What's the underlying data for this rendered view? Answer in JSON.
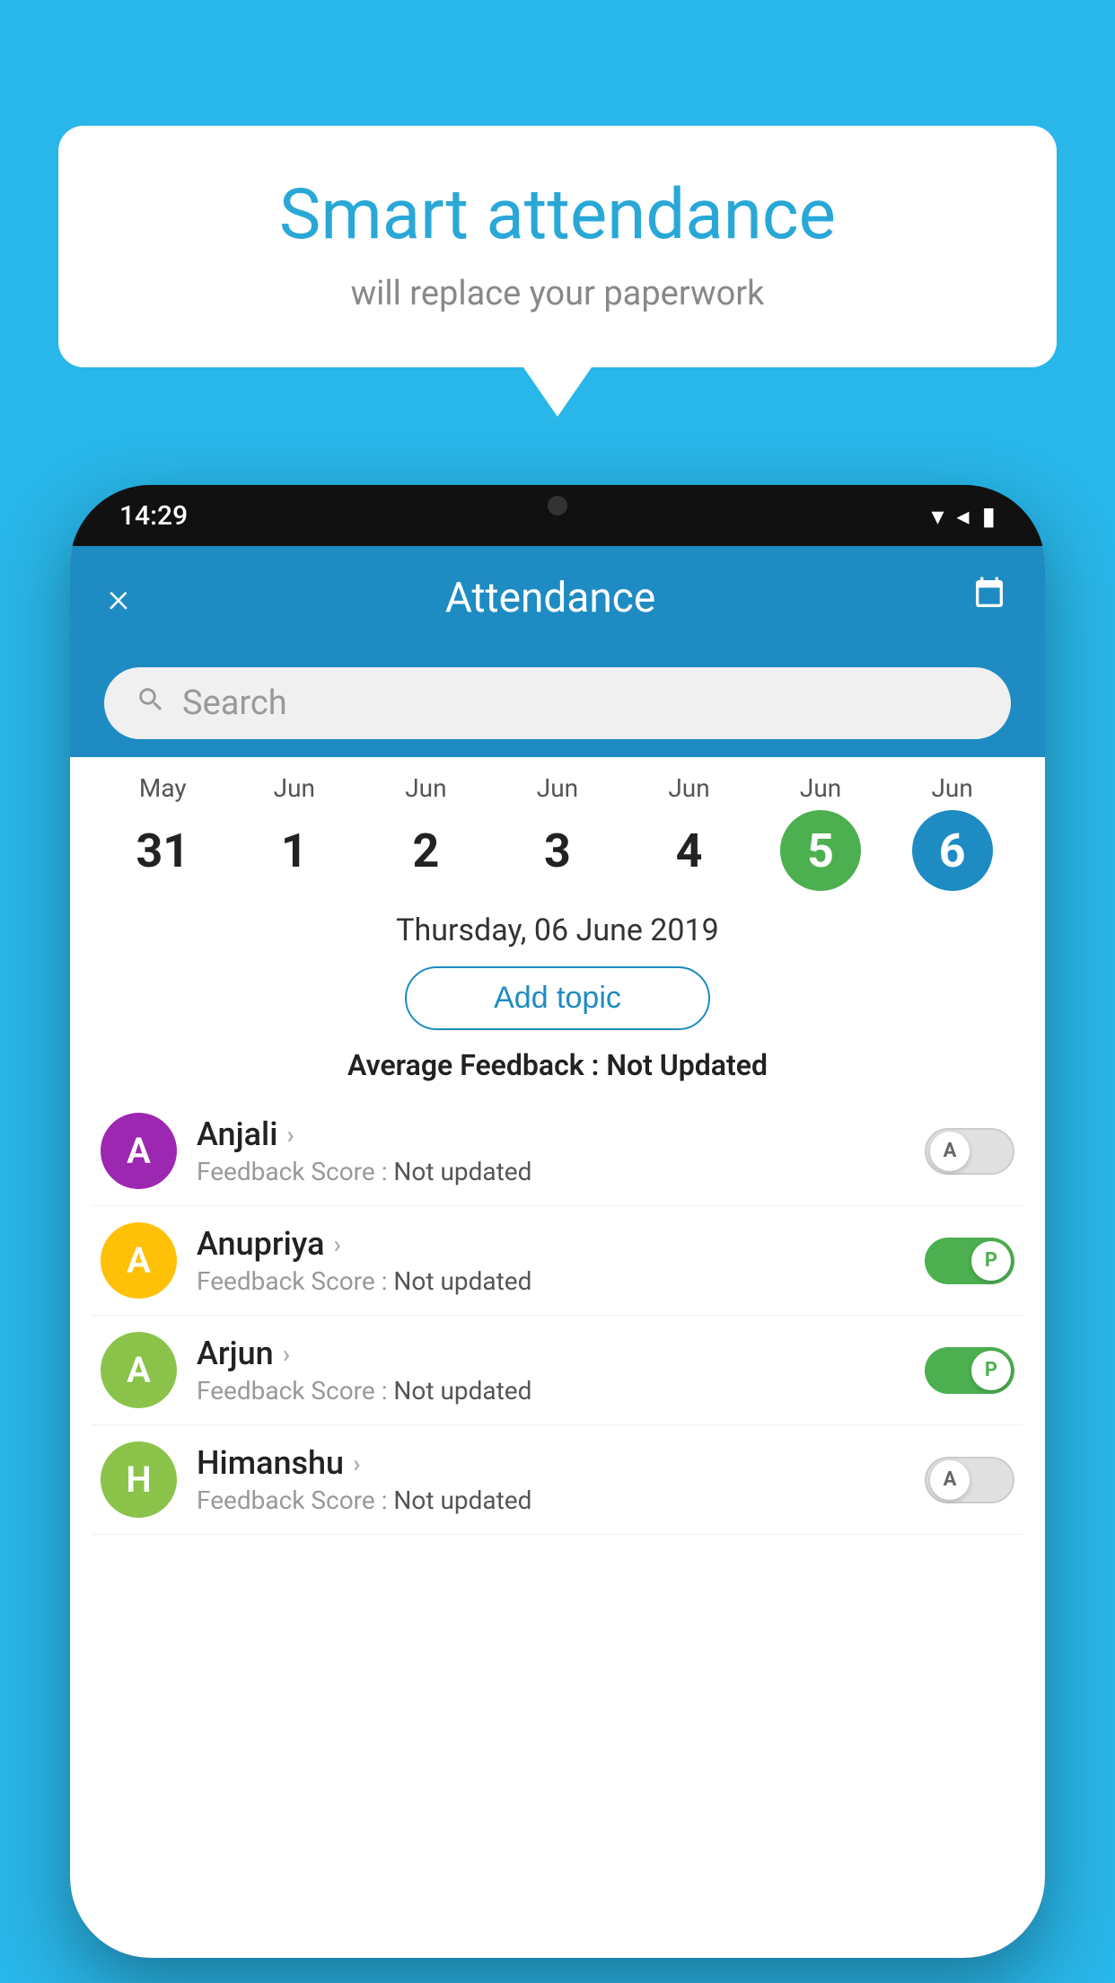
{
  "background": {
    "color": "#29B6E8"
  },
  "speech_bubble": {
    "title": "Smart attendance",
    "subtitle": "will replace your paperwork"
  },
  "phone": {
    "status_bar": {
      "time": "14:29"
    },
    "app_bar": {
      "title": "Attendance",
      "close_label": "×"
    },
    "search": {
      "placeholder": "Search"
    },
    "calendar": {
      "days": [
        {
          "month": "May",
          "date": "31",
          "style": "normal"
        },
        {
          "month": "Jun",
          "date": "1",
          "style": "normal"
        },
        {
          "month": "Jun",
          "date": "2",
          "style": "normal"
        },
        {
          "month": "Jun",
          "date": "3",
          "style": "normal"
        },
        {
          "month": "Jun",
          "date": "4",
          "style": "normal"
        },
        {
          "month": "Jun",
          "date": "5",
          "style": "selected-green"
        },
        {
          "month": "Jun",
          "date": "6",
          "style": "selected-blue"
        }
      ]
    },
    "selected_date": "Thursday, 06 June 2019",
    "add_topic_label": "Add topic",
    "avg_feedback": {
      "label": "Average Feedback : ",
      "value": "Not Updated"
    },
    "students": [
      {
        "name": "Anjali",
        "avatar_letter": "A",
        "avatar_color": "#9C27B0",
        "score_label": "Feedback Score : ",
        "score_value": "Not updated",
        "toggle_state": "off",
        "toggle_letter": "A"
      },
      {
        "name": "Anupriya",
        "avatar_letter": "A",
        "avatar_color": "#FFC107",
        "score_label": "Feedback Score : ",
        "score_value": "Not updated",
        "toggle_state": "on",
        "toggle_letter": "P"
      },
      {
        "name": "Arjun",
        "avatar_letter": "A",
        "avatar_color": "#8BC34A",
        "score_label": "Feedback Score : ",
        "score_value": "Not updated",
        "toggle_state": "on",
        "toggle_letter": "P"
      },
      {
        "name": "Himanshu",
        "avatar_letter": "H",
        "avatar_color": "#8BC34A",
        "score_label": "Feedback Score : ",
        "score_value": "Not updated",
        "toggle_state": "off",
        "toggle_letter": "A"
      }
    ]
  }
}
